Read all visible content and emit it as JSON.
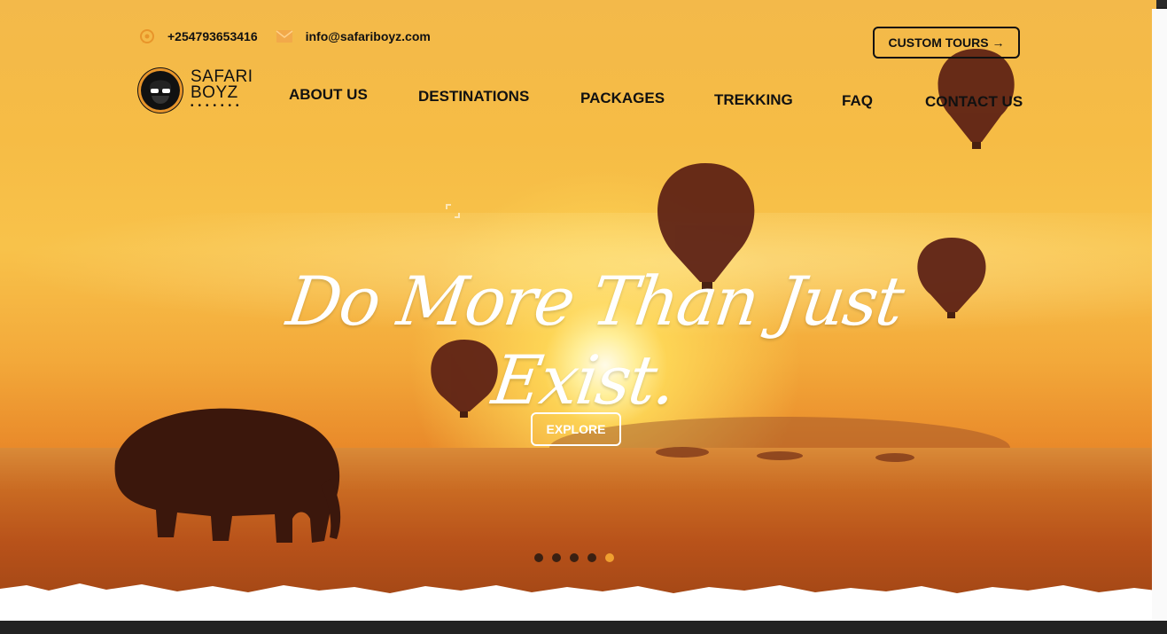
{
  "contact": {
    "phone": "+254793653416",
    "email": "info@safariboyz.com",
    "phone_icon": "whatsapp-icon",
    "email_icon": "envelope-icon"
  },
  "header": {
    "custom_tours_label": "CUSTOM TOURS →"
  },
  "logo": {
    "line1": "SAFARI",
    "line2": "BOYZ",
    "dots": "•••••••"
  },
  "nav": {
    "items": [
      {
        "label": "ABOUT US"
      },
      {
        "label": "DESTINATIONS"
      },
      {
        "label": "PACKAGES"
      },
      {
        "label": "TREKKING"
      },
      {
        "label": "FAQ"
      },
      {
        "label": "CONTACT US"
      }
    ]
  },
  "hero": {
    "headline": "Do More Than Just Exist.",
    "cta_label": "EXPLORE",
    "slides_total": 5,
    "active_slide": 5
  },
  "colors": {
    "accent": "#f0a030",
    "text_dark": "#111111",
    "sky": "#f6bc45"
  }
}
